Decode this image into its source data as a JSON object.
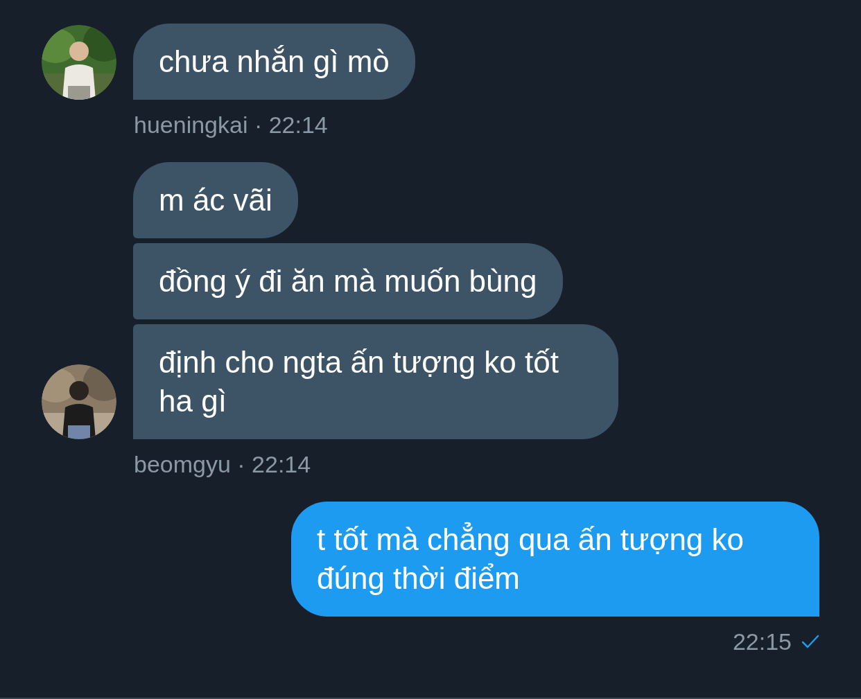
{
  "conversation": [
    {
      "kind": "received",
      "messages": [
        "chưa nhắn gì mò"
      ],
      "meta": "hueningkai · 22:14"
    },
    {
      "kind": "received",
      "messages": [
        "m ác vãi",
        "đồng ý đi ăn mà muốn bùng",
        "định cho ngta ấn tượng ko tốt ha gì"
      ],
      "meta": "beomgyu · 22:14"
    },
    {
      "kind": "sent",
      "messages": [
        "t tốt mà chẳng qua ấn tượng ko đúng thời điểm"
      ],
      "meta": "22:15",
      "read": true
    }
  ]
}
